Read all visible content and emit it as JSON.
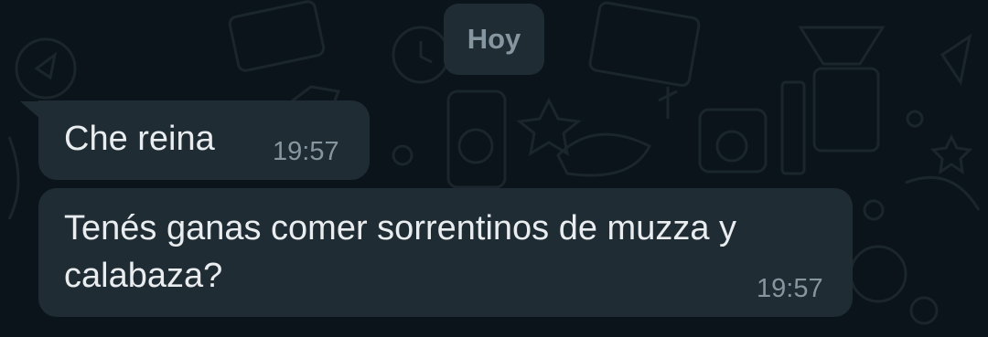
{
  "chat": {
    "date_divider": "Hoy",
    "messages": [
      {
        "text": "Che reina",
        "time": "19:57"
      },
      {
        "text": "Tenés ganas comer sorrentinos de muzza y calabaza?",
        "time": "19:57"
      }
    ]
  },
  "colors": {
    "background": "#0b141a",
    "bubble": "#1f2c34",
    "text": "#e9edef",
    "meta": "#8696a0"
  },
  "icons": [
    "wallpaper-doodle-pattern",
    "bubble-tail"
  ]
}
